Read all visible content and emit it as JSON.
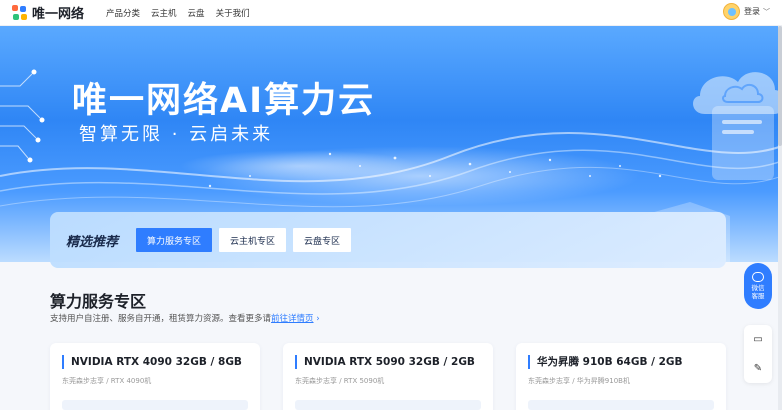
{
  "header": {
    "brand": "唯一网络",
    "nav": [
      "产品分类",
      "云主机",
      "云盘",
      "关于我们"
    ],
    "login": "登录"
  },
  "banner": {
    "title": "唯一网络AI算力云",
    "subtitle": "智算无限 · 云启未来"
  },
  "recommend": {
    "title": "精选推荐",
    "tabs": [
      "算力服务专区",
      "云主机专区",
      "云盘专区"
    ],
    "active_tab": 0
  },
  "section": {
    "title": "算力服务专区",
    "desc": "支持用户自注册、服务自开通，租赁算力资源。查看更多请",
    "link": "前往详情页",
    "arrow": "›"
  },
  "cards": [
    {
      "title": "NVIDIA RTX 4090 32GB / 8GB",
      "sub": "东莞森步志享 / RTX 4090机"
    },
    {
      "title": "NVIDIA RTX 5090 32GB / 2GB",
      "sub": "东莞森步志享 / RTX 5090机"
    },
    {
      "title": "华为昇腾 910B 64GB / 2GB",
      "sub": "东莞森步志享 / 华为昇腾910B机"
    }
  ],
  "float": {
    "service_label": "微信客服",
    "service_line1": "微信",
    "service_line2": "客服"
  },
  "colors": {
    "accent": "#2f7dff",
    "banner_top": "#5aa9ff",
    "banner_mid": "#2f86f5"
  }
}
